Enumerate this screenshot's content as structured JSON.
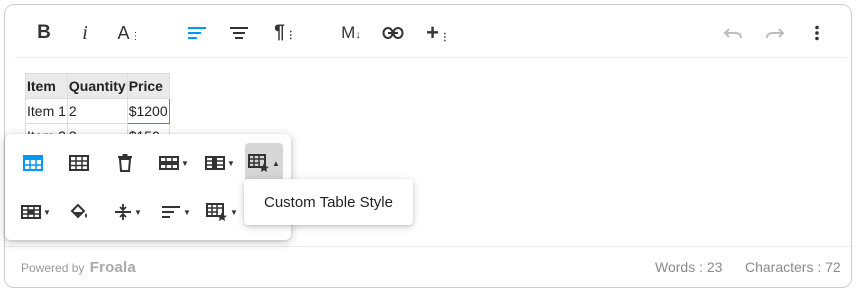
{
  "toolbar": {
    "bold": "B",
    "italic": "i",
    "font_size": "A",
    "paragraph": "¶",
    "markdown": "M",
    "insert": "+",
    "buttons": [
      "bold-icon",
      "italic-icon",
      "text-size-icon",
      "align-left-icon",
      "align-center-icon",
      "paragraph-format-icon",
      "markdown-icon",
      "link-icon",
      "plus-icon",
      "undo-icon",
      "redo-icon",
      "more-icon"
    ]
  },
  "table": {
    "headers": [
      "Item",
      "Quantity",
      "Price"
    ],
    "rows": [
      [
        "Item 1",
        "2",
        "$1200"
      ],
      [
        "Item 2",
        "3",
        "$150"
      ]
    ]
  },
  "table_popup": {
    "row1": [
      "table-header-icon",
      "table-icon",
      "trash-icon",
      "table-rows-icon",
      "table-columns-icon",
      "table-style-icon"
    ],
    "row2": [
      "table-cells-icon",
      "cell-background-icon",
      "vertical-align-icon",
      "horizontal-align-icon",
      "cell-style-icon"
    ]
  },
  "dropdown": {
    "item": "Custom Table Style"
  },
  "footer": {
    "powered_by": "Powered by",
    "brand": "Froala",
    "words": "Words : 23",
    "characters": "Characters : 72"
  },
  "colors": {
    "accent": "#0098f7",
    "border": "#cccccc",
    "selected_cell": "#2196f3"
  }
}
